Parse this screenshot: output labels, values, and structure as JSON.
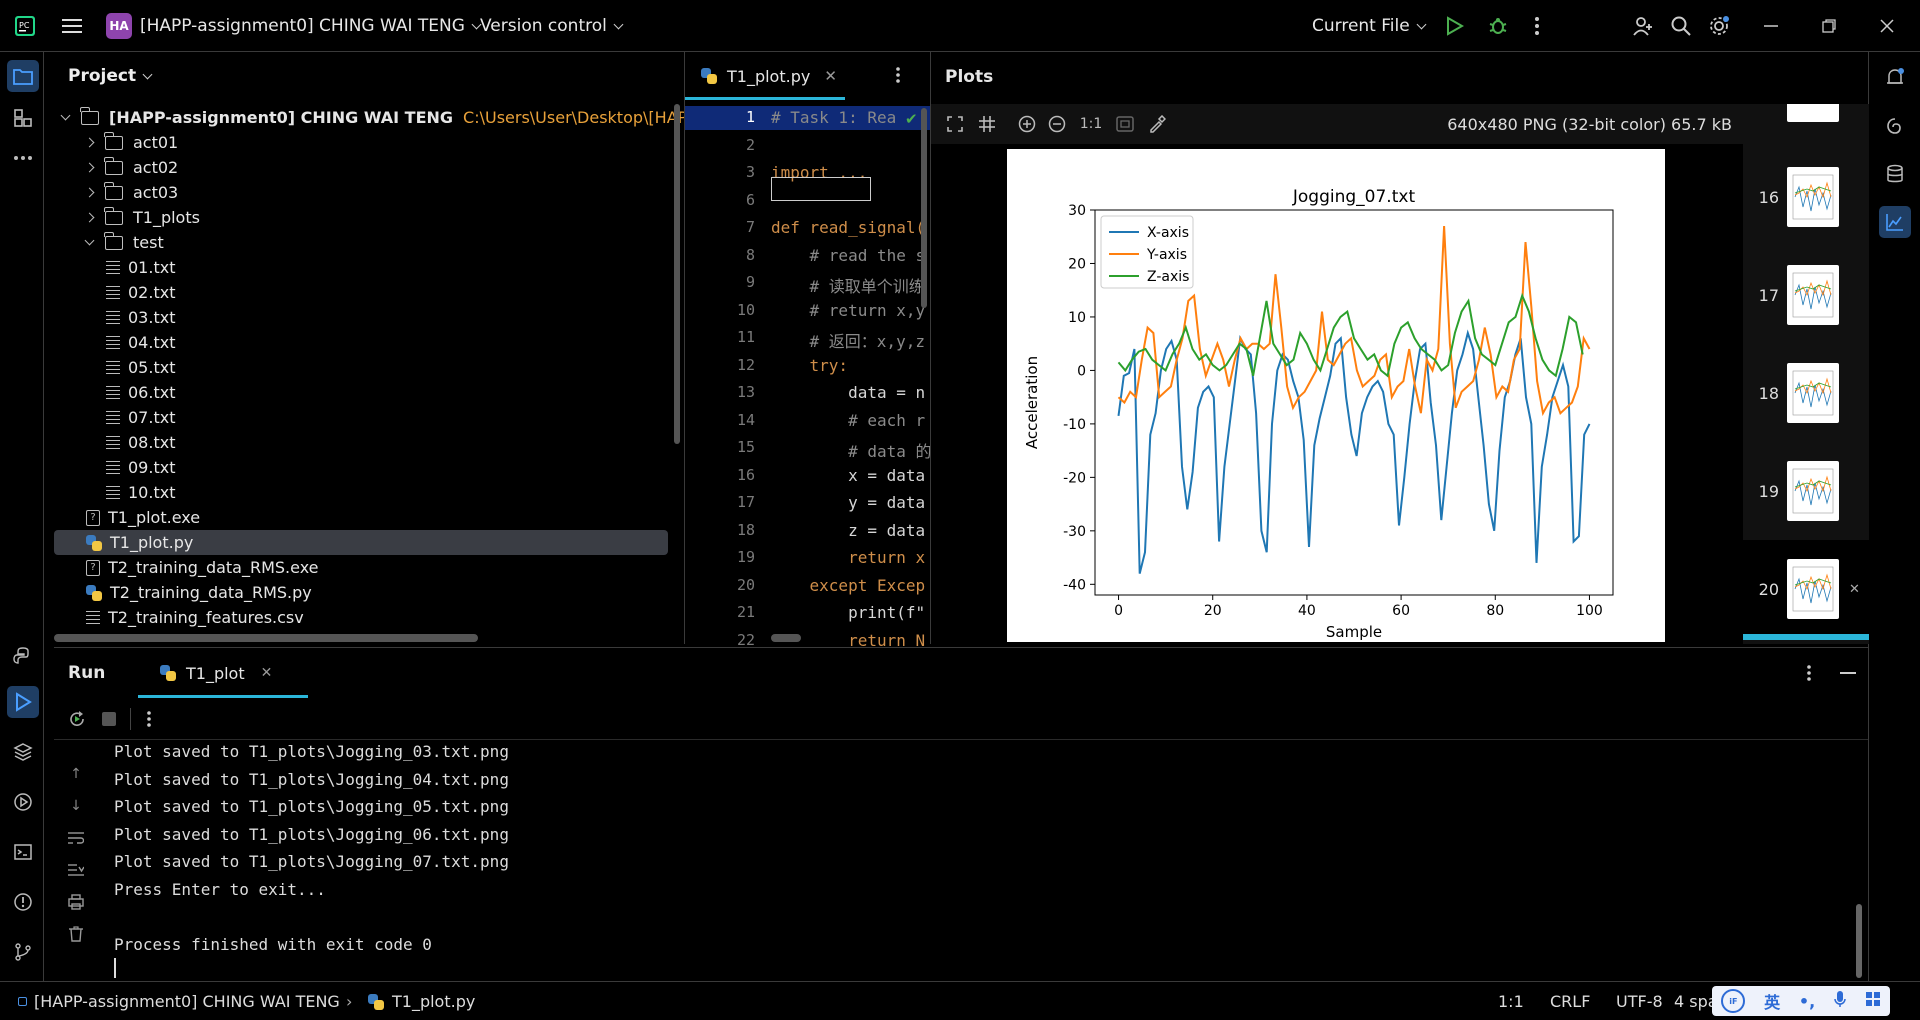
{
  "titlebar": {
    "project_badge": "HA",
    "project_name": "[HAPP-assignment0] CHING WAI TENG",
    "vcs": "Version control",
    "run_config": "Current File"
  },
  "project_panel": {
    "title": "Project",
    "root_name": "[HAPP-assignment0] CHING WAI TENG",
    "root_path": "C:\\Users\\User\\Desktop\\[HAP",
    "items": [
      {
        "label": "act01",
        "kind": "folder"
      },
      {
        "label": "act02",
        "kind": "folder"
      },
      {
        "label": "act03",
        "kind": "folder"
      },
      {
        "label": "T1_plots",
        "kind": "folder"
      },
      {
        "label": "test",
        "kind": "folder-open"
      },
      {
        "label": "01.txt",
        "kind": "txt"
      },
      {
        "label": "02.txt",
        "kind": "txt"
      },
      {
        "label": "03.txt",
        "kind": "txt"
      },
      {
        "label": "04.txt",
        "kind": "txt"
      },
      {
        "label": "05.txt",
        "kind": "txt"
      },
      {
        "label": "06.txt",
        "kind": "txt"
      },
      {
        "label": "07.txt",
        "kind": "txt"
      },
      {
        "label": "08.txt",
        "kind": "txt"
      },
      {
        "label": "09.txt",
        "kind": "txt"
      },
      {
        "label": "10.txt",
        "kind": "txt"
      },
      {
        "label": "T1_plot.exe",
        "kind": "exe"
      },
      {
        "label": "T1_plot.py",
        "kind": "py"
      },
      {
        "label": "T2_training_data_RMS.exe",
        "kind": "exe"
      },
      {
        "label": "T2_training_data_RMS.py",
        "kind": "py"
      },
      {
        "label": "T2_training_features.csv",
        "kind": "txt"
      }
    ]
  },
  "editor": {
    "tab": "T1_plot.py",
    "line_numbers": [
      "1",
      "2",
      "3",
      "6",
      "7",
      "8",
      "9",
      "10",
      "11",
      "12",
      "13",
      "14",
      "15",
      "16",
      "17",
      "18",
      "19",
      "20",
      "21",
      "22"
    ],
    "lines": [
      "# Task 1: Rea",
      "",
      "import ...",
      "",
      "def read_signal(",
      "    # read the s",
      "    # 读取单个训练",
      "    # return x,y",
      "    # 返回：x,y,z",
      "    try:",
      "        data = n",
      "        # each r",
      "        # data 的",
      "        x = data",
      "        y = data",
      "        z = data",
      "        return x",
      "    except Excep",
      "        print(f\"",
      "        return N"
    ]
  },
  "plots": {
    "title": "Plots",
    "zoom_label": "1:1",
    "image_info": "640x480 PNG (32-bit color) 65.7 kB",
    "thumbnails": [
      "16",
      "17",
      "18",
      "19",
      "20"
    ],
    "selected_thumb": "20"
  },
  "chart_data": {
    "type": "line",
    "title": "Jogging_07.txt",
    "xlabel": "Sample",
    "ylabel": "Acceleration",
    "xlim": [
      -5,
      105
    ],
    "ylim": [
      -42,
      30
    ],
    "xticks": [
      0,
      20,
      40,
      60,
      80,
      100
    ],
    "yticks": [
      -40,
      -30,
      -20,
      -10,
      0,
      10,
      20,
      30
    ],
    "legend_position": "top-left",
    "grid": false,
    "series": [
      {
        "name": "X-axis",
        "color": "#1f77b4",
        "values": [
          -8.5,
          -1,
          -0.5,
          4,
          -38,
          -34,
          -12,
          -8,
          0,
          4,
          5.5,
          2,
          -18,
          -26,
          -19,
          -7,
          -4,
          -3,
          -5,
          -32,
          -18,
          -10,
          -2,
          6,
          4,
          3,
          -8,
          -30,
          -34,
          -10,
          0,
          3,
          2,
          -2,
          -5,
          -13,
          -33,
          -14,
          -9,
          -5,
          -1,
          5,
          6,
          -5,
          -12,
          -16,
          -8,
          -5,
          -3,
          -2,
          -4,
          -10,
          -12,
          -29,
          -20,
          -10,
          -2,
          4,
          5,
          -6,
          -14,
          -28,
          -18,
          -8,
          0,
          3,
          7,
          4,
          -5,
          -14,
          -25,
          -30,
          -15,
          -5,
          -2,
          3,
          6,
          -5,
          -10,
          -36,
          -18,
          -12,
          -5,
          -2,
          1,
          -3,
          -32,
          -31,
          -12,
          -10
        ],
        "x_step": 1.1236
      },
      {
        "name": "Y-axis",
        "color": "#ff7f0e",
        "values": [
          -5,
          -6,
          -4,
          -5,
          2,
          8,
          7,
          -5,
          -4,
          -3,
          2,
          6,
          13,
          14,
          4,
          -1,
          2,
          5,
          2,
          -3,
          2,
          6,
          4,
          5,
          5,
          4,
          5,
          18,
          8,
          -3,
          -7,
          -5,
          -4,
          -2,
          0,
          11,
          2,
          1,
          3,
          5,
          6,
          0,
          -3,
          -2,
          -1,
          2,
          3,
          -5,
          -3,
          -2,
          4,
          -3,
          -8,
          2,
          0,
          4,
          27,
          5,
          -7,
          -4,
          -3,
          -2,
          2,
          8,
          3,
          -5,
          -3,
          -4,
          2,
          4,
          24,
          12,
          -2,
          -8,
          -6,
          -5,
          -8,
          -7,
          -6,
          -3,
          6,
          4
        ],
        "x_step": 1.2346
      },
      {
        "name": "Z-axis",
        "color": "#2ca02c",
        "values": [
          1.5,
          0,
          2,
          3.5,
          4,
          2,
          1,
          0,
          3,
          5,
          8,
          4,
          2,
          3,
          1,
          0,
          1,
          3,
          5,
          4,
          -1,
          6,
          13,
          5,
          3,
          1,
          2,
          7,
          5,
          2,
          0,
          4,
          8,
          10,
          11,
          6,
          4,
          2,
          3,
          0,
          -1,
          5,
          8,
          9,
          6,
          4,
          3,
          2,
          0,
          1,
          7,
          11,
          13,
          6,
          3,
          2,
          1,
          5,
          9,
          10,
          14,
          11,
          6,
          2,
          0,
          -1,
          4,
          10,
          9,
          3
        ],
        "x_step": 1.4286
      }
    ]
  },
  "run_panel": {
    "title": "Run",
    "tab": "T1_plot",
    "console": [
      "Plot saved to T1_plots\\Jogging_03.txt.png",
      "Plot saved to T1_plots\\Jogging_04.txt.png",
      "Plot saved to T1_plots\\Jogging_05.txt.png",
      "Plot saved to T1_plots\\Jogging_06.txt.png",
      "Plot saved to T1_plots\\Jogging_07.txt.png",
      "Press Enter to exit...",
      "",
      "Process finished with exit code 0"
    ]
  },
  "statusbar": {
    "breadcrumb_project": "[HAPP-assignment0] CHING WAI TENG",
    "breadcrumb_file": "T1_plot.py",
    "position": "1:1",
    "line_sep": "CRLF",
    "encoding": "UTF-8",
    "indent": "4 spa",
    "ime_lang": "英"
  }
}
